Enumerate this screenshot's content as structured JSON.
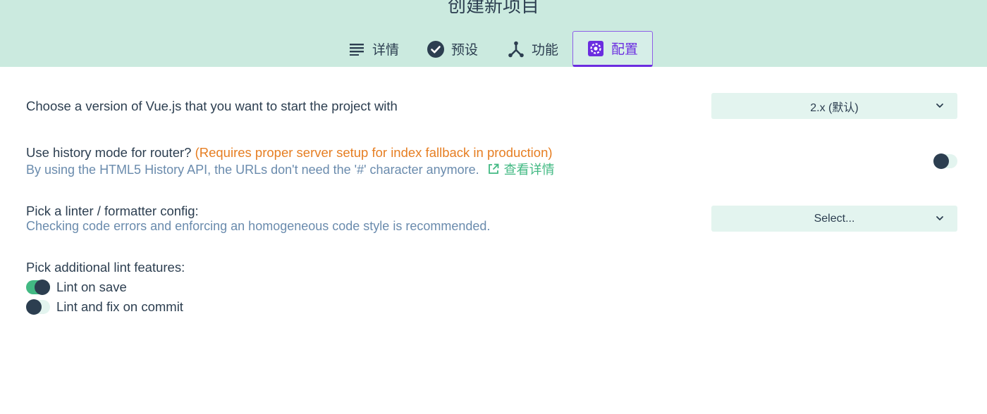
{
  "header": {
    "title": "创建新项目",
    "tabs": [
      {
        "label": "详情",
        "icon": "list-icon"
      },
      {
        "label": "预设",
        "icon": "check-circle-icon"
      },
      {
        "label": "功能",
        "icon": "fork-icon"
      },
      {
        "label": "配置",
        "icon": "settings-icon",
        "selected": true
      }
    ]
  },
  "config": {
    "vue_version": {
      "label": "Choose a version of Vue.js that you want to start the project with",
      "value": "2.x (默认)"
    },
    "history_mode": {
      "label": "Use history mode for router?",
      "warning": "(Requires proper server setup for index fallback in production)",
      "description": "By using the HTML5 History API, the URLs don't need the '#' character anymore.",
      "more_link": "查看详情",
      "enabled": false
    },
    "linter": {
      "label": "Pick a linter / formatter config:",
      "description": "Checking code errors and enforcing an homogeneous code style is recommended.",
      "value": "Select..."
    },
    "lint_features": {
      "label": "Pick additional lint features:",
      "options": [
        {
          "label": "Lint on save",
          "checked": true
        },
        {
          "label": "Lint and fix on commit",
          "checked": false
        }
      ]
    }
  },
  "colors": {
    "header_bg": "#cbeadf",
    "accent_green": "#42b983",
    "accent_purple": "#6b2de0",
    "warning_orange": "#e67e22",
    "description_blue": "#6a8bad",
    "text_dark": "#2c3e50"
  }
}
